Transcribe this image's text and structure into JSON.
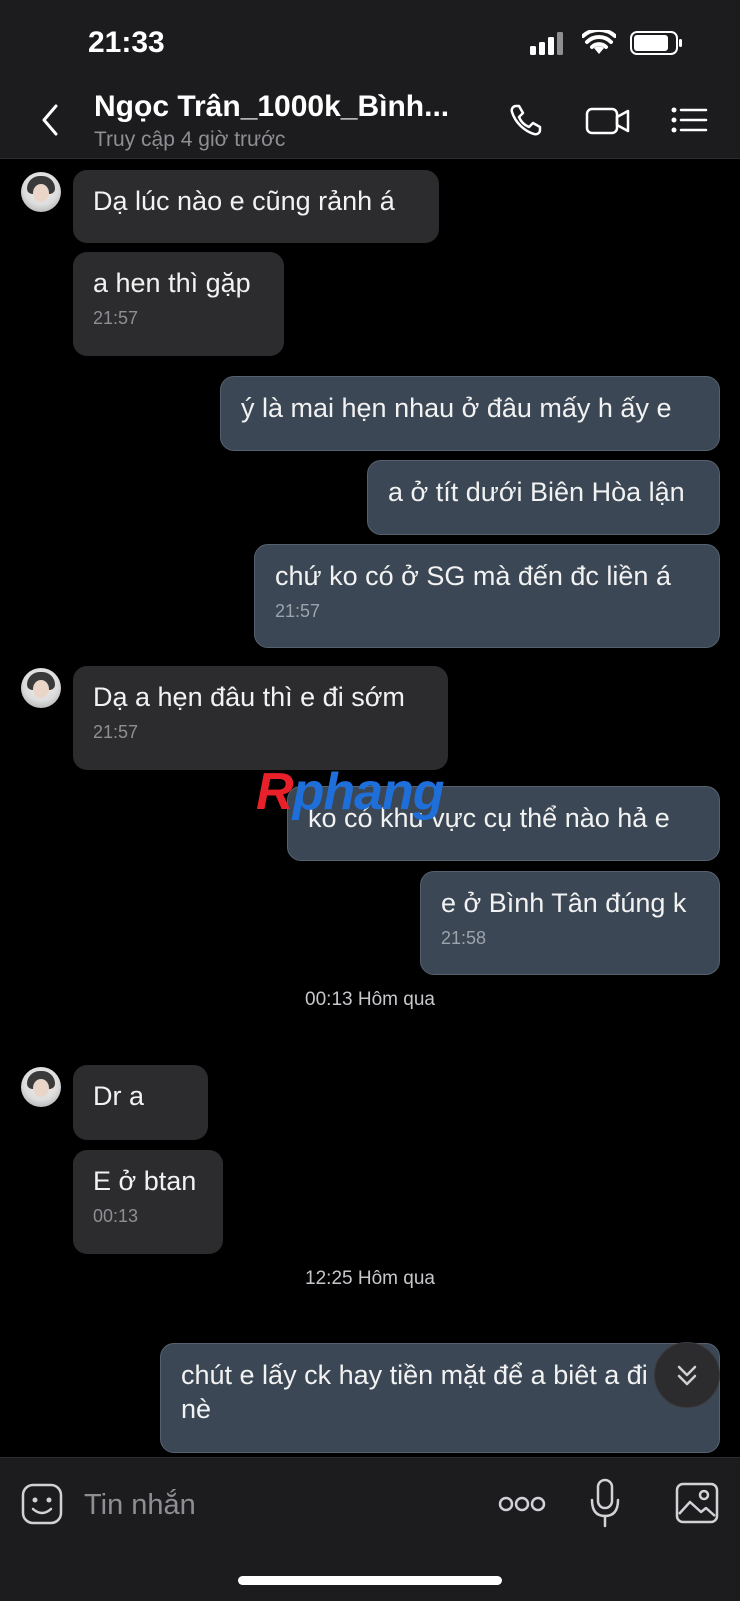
{
  "status_bar": {
    "time": "21:33",
    "icons": [
      "signal-icon",
      "wifi-icon",
      "battery-icon"
    ]
  },
  "header": {
    "title": "Ngọc Trân_1000k_Bình...",
    "subtitle": "Truy cập 4 giờ trước",
    "icons": [
      "back-icon",
      "phone-icon",
      "video-call-icon",
      "menu-list-icon"
    ]
  },
  "messages": [
    {
      "direction": "in",
      "text": "Dạ lúc nào e cũng rảnh á",
      "time": ""
    },
    {
      "direction": "in",
      "text": "a hen thì gặp",
      "time": "21:57"
    },
    {
      "direction": "out",
      "text": "ý là mai hẹn nhau ở đâu mấy h ấy e",
      "time": ""
    },
    {
      "direction": "out",
      "text": "a ở tít dưới Biên Hòa lận",
      "time": ""
    },
    {
      "direction": "out",
      "text": "chứ ko có ở SG mà đến đc liền á",
      "time": "21:57"
    },
    {
      "direction": "in",
      "text": "Dạ a hẹn đâu thì e đi sớm",
      "time": "21:57"
    },
    {
      "direction": "out",
      "text": "ko có khu vực cụ thể nào hả e",
      "time": ""
    },
    {
      "direction": "out",
      "text": "e ở Bình Tân đúng k",
      "time": "21:58"
    },
    {
      "direction": "in",
      "text": "Dr a",
      "time": ""
    },
    {
      "direction": "in",
      "text": "E ở btan",
      "time": "00:13"
    },
    {
      "direction": "out",
      "text": "chút e lấy ck hay tiền mặt để a biêt a đi rút nè",
      "time": ""
    }
  ],
  "day_separators": [
    "00:13 Hôm qua",
    "12:25 Hôm qua"
  ],
  "watermark": {
    "part1": "R",
    "part2": "phang"
  },
  "input_bar": {
    "placeholder": "Tin nhắn",
    "icons": [
      "sticker-icon",
      "more-icon",
      "microphone-icon",
      "image-icon"
    ]
  },
  "colors": {
    "background": "#000000",
    "incoming_bubble": "#2c2c2e",
    "outgoing_bubble": "#3b4754",
    "watermark_red": "#e8202a",
    "watermark_blue": "#1e6fd9"
  }
}
